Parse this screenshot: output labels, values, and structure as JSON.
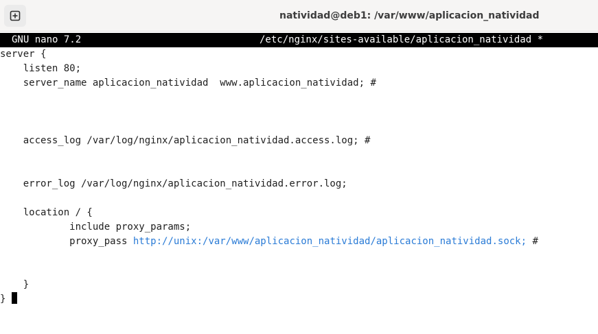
{
  "window": {
    "title": "natividad@deb1: /var/www/aplicacion_natividad"
  },
  "nano": {
    "version": "GNU nano 7.2",
    "filename": "/etc/nginx/sites-available/aplicacion_natividad *"
  },
  "code": {
    "line1": "server {",
    "line2": "    listen 80;",
    "line3": "    server_name aplicacion_natividad  www.aplicacion_natividad; #",
    "line7": "    access_log /var/log/nginx/aplicacion_natividad.access.log; #",
    "line10": "    error_log /var/log/nginx/aplicacion_natividad.error.log;",
    "line12": "    location / {",
    "line13": "            include proxy_params;",
    "line14_prefix": "            proxy_pass ",
    "line14_url": "http://unix:/var/www/aplicacion_natividad/aplicacion_natividad.sock;",
    "line14_suffix": " #",
    "line17": "    }",
    "line18": "}"
  },
  "colors": {
    "url": "#2a7bd6",
    "header_bg": "#000000",
    "header_fg": "#ffffff"
  },
  "icons": {
    "new_tab": "plus-square-icon"
  }
}
